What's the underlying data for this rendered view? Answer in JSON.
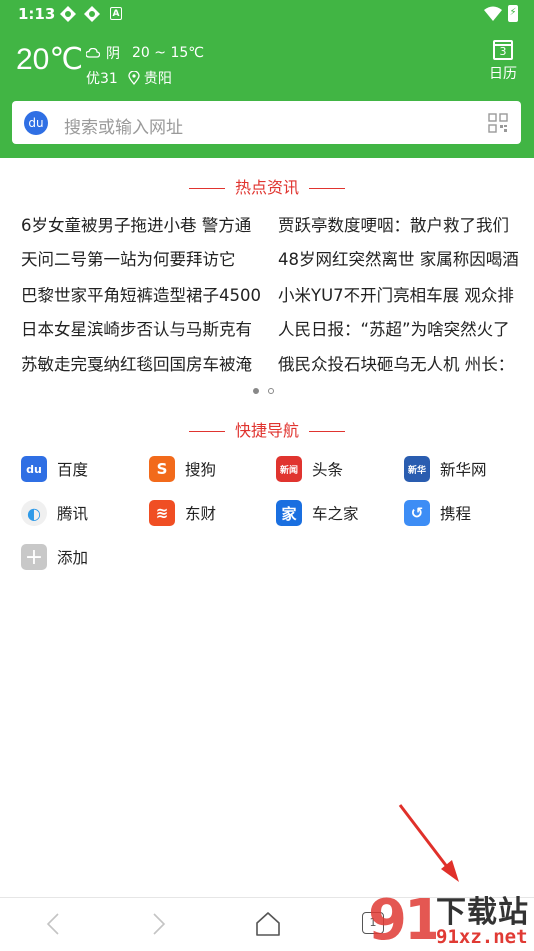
{
  "status_bar": {
    "time": "1:13",
    "badge_letter": "A",
    "battery_text": "⚡"
  },
  "weather": {
    "temperature": "20℃",
    "condition": "阴",
    "range": "20 ~ 15℃",
    "air_quality": "优31",
    "location": "贵阳"
  },
  "calendar": {
    "day": "3",
    "label": "日历"
  },
  "search": {
    "engine_badge": "du",
    "placeholder": "搜索或输入网址"
  },
  "hot_news": {
    "title": "热点资讯",
    "left": [
      "6岁女童被男子拖进小巷 警方通",
      "天问二号第一站为何要拜访它",
      "巴黎世家平角短裤造型裙子4500",
      "日本女星滨崎步否认与马斯克有",
      "苏敏走完戛纳红毯回国房车被淹"
    ],
    "right": [
      "贾跃亭数度哽咽：散户救了我们",
      "48岁网红突然离世 家属称因喝酒",
      "小米YU7不开门亮相车展 观众排",
      "人民日报：“苏超”为啥突然火了",
      "俄民众投石块砸乌无人机 州长："
    ]
  },
  "quick_nav": {
    "title": "快捷导航",
    "items": [
      {
        "label": "百度",
        "icon": "baidu-icon",
        "color": "#2f6fe4",
        "glyph": "du"
      },
      {
        "label": "搜狗",
        "icon": "sogou-icon",
        "color": "#f26a1b",
        "glyph": "S"
      },
      {
        "label": "头条",
        "icon": "toutiao-icon",
        "color": "#e0342f",
        "glyph": "新闻"
      },
      {
        "label": "新华网",
        "icon": "xinhua-icon",
        "color": "#2a5db0",
        "glyph": "新华"
      },
      {
        "label": "腾讯",
        "icon": "tencent-icon",
        "color": "#f0f0f0",
        "glyph": "◐"
      },
      {
        "label": "东财",
        "icon": "dongcai-icon",
        "color": "#f04e23",
        "glyph": "≋"
      },
      {
        "label": "车之家",
        "icon": "autohome-icon",
        "color": "#1a6fe0",
        "glyph": "家"
      },
      {
        "label": "携程",
        "icon": "ctrip-icon",
        "color": "#3d8df5",
        "glyph": "↺"
      },
      {
        "label": "添加",
        "icon": "add-icon",
        "color": "#c8c8c8",
        "glyph": "+"
      }
    ]
  },
  "bottom_bar": {
    "tabs_count": "1"
  },
  "watermark": {
    "text_top": "下载站",
    "text_bottom": "91xz.net"
  },
  "colors": {
    "brand_green": "#41b544",
    "accent_red": "#e0342f"
  }
}
